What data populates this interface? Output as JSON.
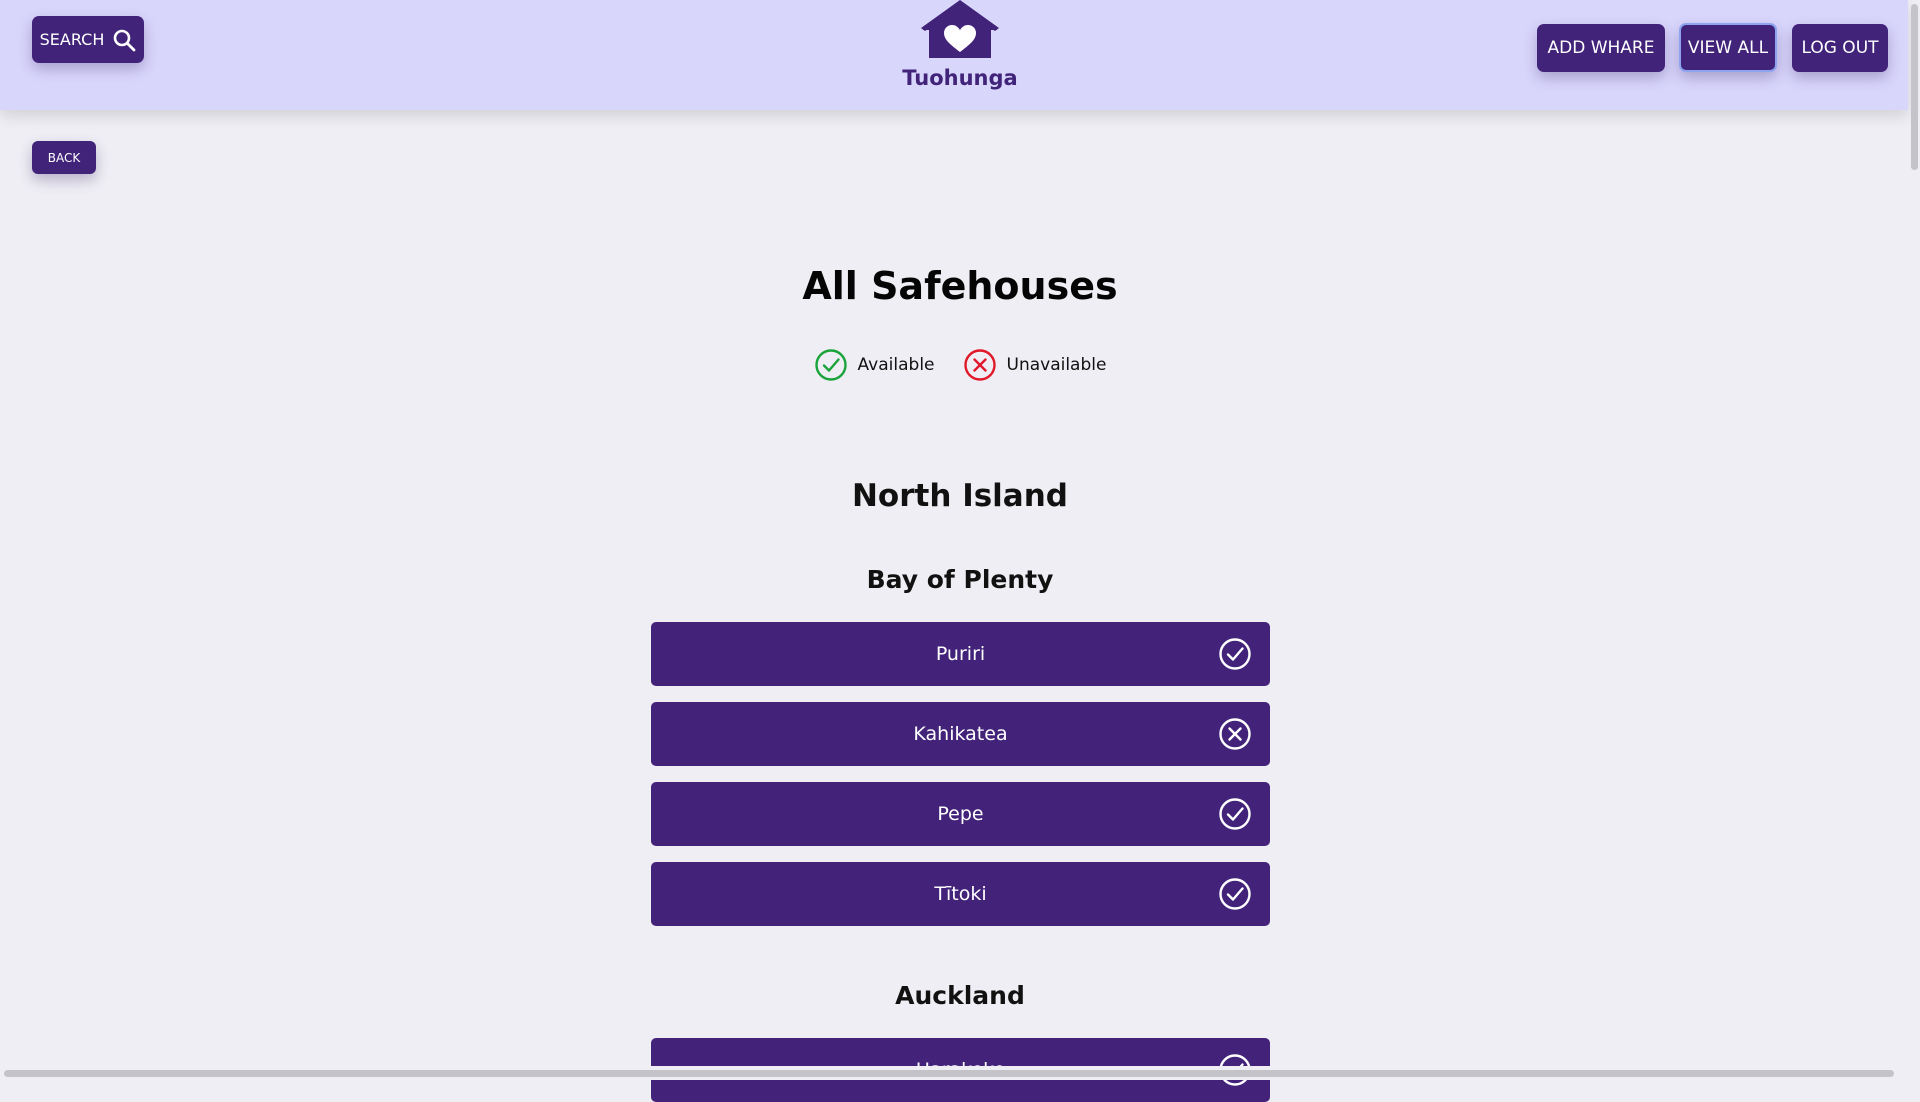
{
  "header": {
    "search_label": "SEARCH",
    "brand": "Tuohunga",
    "add_label": "ADD WHARE",
    "view_all_label": "VIEW ALL",
    "logout_label": "LOG OUT"
  },
  "back_label": "BACK",
  "page_title": "All Safehouses",
  "legend": {
    "available": "Available",
    "unavailable": "Unavailable"
  },
  "island": "North Island",
  "regions": [
    {
      "name": "Bay of Plenty",
      "houses": [
        {
          "name": "Puriri",
          "status": "available"
        },
        {
          "name": "Kahikatea",
          "status": "unavailable"
        },
        {
          "name": "Pepe",
          "status": "available"
        },
        {
          "name": "Tītoki",
          "status": "available"
        }
      ]
    },
    {
      "name": "Auckland",
      "houses": [
        {
          "name": "Harakeke",
          "status": "available"
        }
      ]
    }
  ],
  "colors": {
    "primary": "#41237a",
    "header_bg": "#d9d6fc",
    "page_bg": "#efeef4",
    "available": "#1aa33a",
    "unavailable": "#e0192a"
  },
  "icons": {
    "search": "search-icon",
    "logo": "house-heart-icon",
    "available": "check-circle-icon",
    "unavailable": "x-circle-icon"
  }
}
